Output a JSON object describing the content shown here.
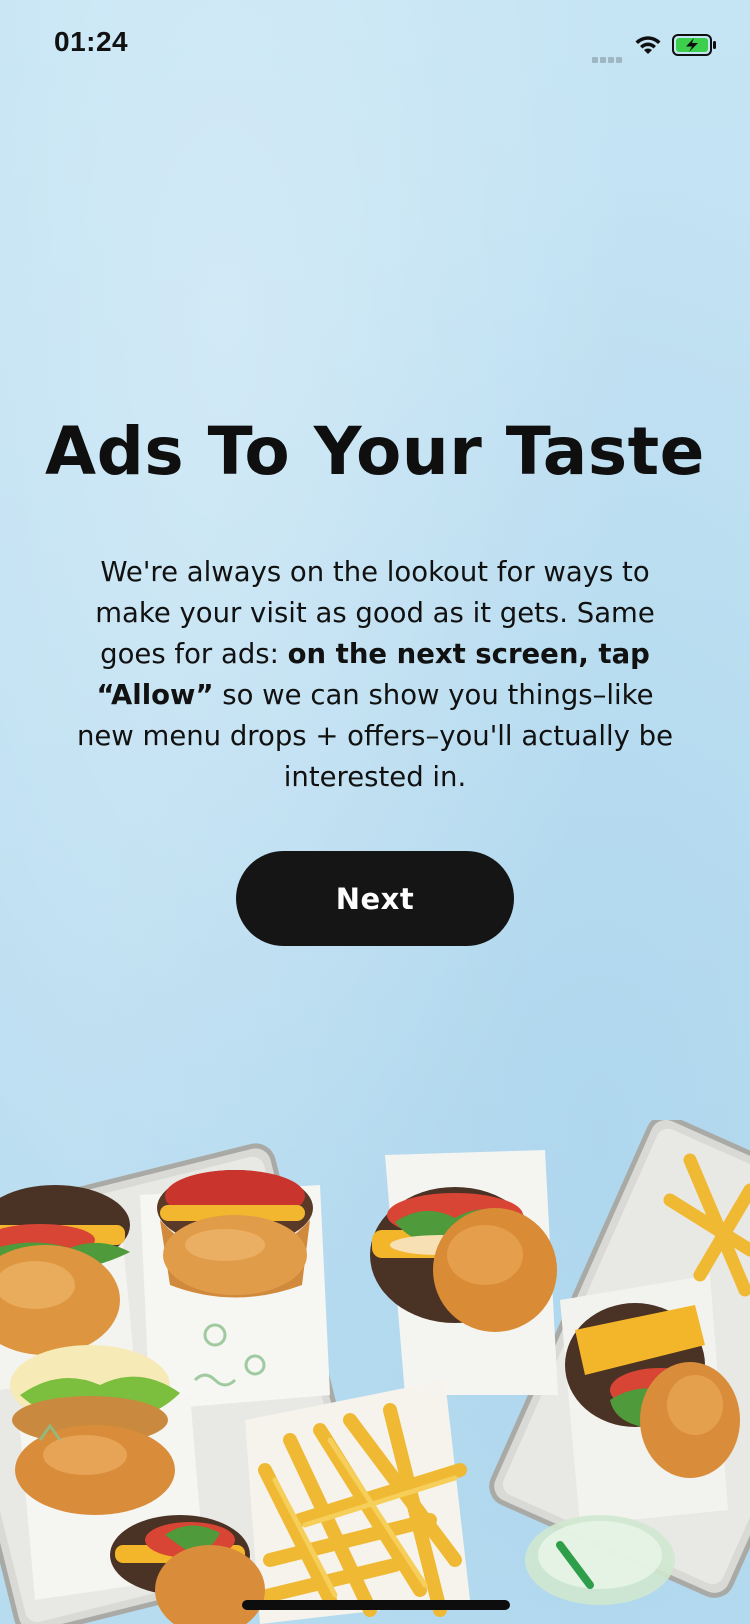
{
  "status_bar": {
    "time": "01:24",
    "icons": [
      "signal-icon",
      "wifi-icon",
      "battery-charging-icon"
    ],
    "battery_color": "#3ccf4e"
  },
  "content": {
    "title": "Ads To Your Taste",
    "body_lead": "We're always on the lookout for ways to make your visit as good as it gets. Same goes for ads: ",
    "body_bold": "on the next screen, tap “Allow”",
    "body_tail": " so we can show you things–like new menu drops + offers–you'll actually be interested in.",
    "next_label": "Next"
  },
  "illustration": {
    "subject": "burgers-and-fries-image"
  },
  "colors": {
    "background": "#bfe1f3",
    "button": "#151515",
    "button_text": "#ffffff",
    "text": "#111111"
  }
}
